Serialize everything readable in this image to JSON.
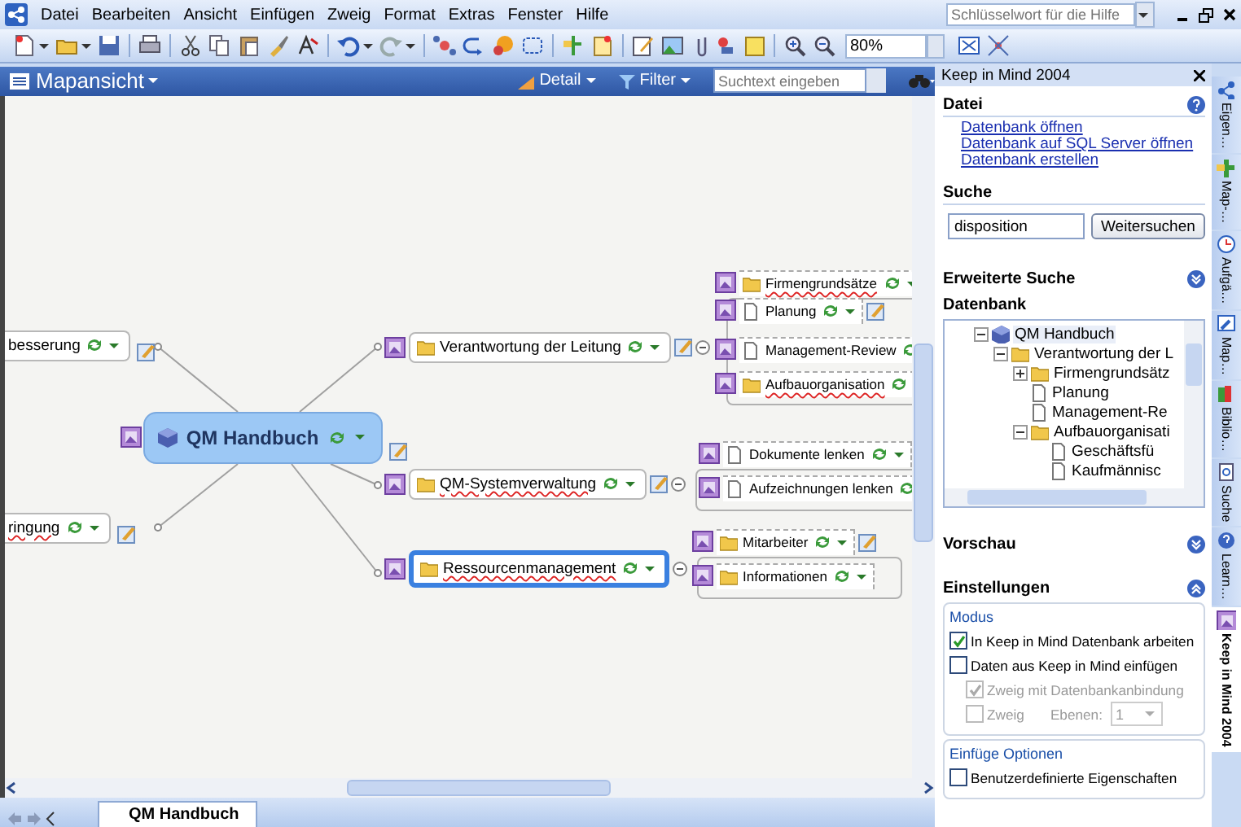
{
  "menu": [
    "Datei",
    "Bearbeiten",
    "Ansicht",
    "Einfügen",
    "Zweig",
    "Format",
    "Extras",
    "Fenster",
    "Hilfe"
  ],
  "help_search": {
    "placeholder": "Schlüsselwort für die Hilfe"
  },
  "toolbar": {
    "zoom": "80%"
  },
  "map_view": {
    "title": "Mapansicht",
    "detail_button": "Detail",
    "filter_button": "Filter",
    "search": {
      "placeholder": "Suchtext eingeben"
    },
    "central_topic": {
      "label": "QM Handbuch",
      "note": true
    },
    "left_topics": [
      {
        "label": "besserung",
        "spelling_error": false,
        "selected": false,
        "note": true
      },
      {
        "label": "ringung",
        "spelling_error": true,
        "selected": false,
        "note": true
      }
    ],
    "right_topics": [
      {
        "label": "Verantwortung der Leitung",
        "kind": "folder",
        "spelling_error": false,
        "selected": false,
        "expanded": true,
        "note": true,
        "children": [
          {
            "label": "Firmengrundsätze",
            "kind": "folder",
            "spelling_error": true,
            "selected": false,
            "note": false
          },
          {
            "label": "Planung",
            "kind": "document",
            "spelling_error": false,
            "selected": false,
            "note": true
          },
          {
            "label": "Management-Review",
            "kind": "document",
            "spelling_error": false,
            "selected": false,
            "note": false
          },
          {
            "label": "Aufbauorganisation",
            "kind": "folder",
            "spelling_error": true,
            "selected": false,
            "note": false
          }
        ]
      },
      {
        "label": "QM-Systemverwaltung",
        "kind": "folder",
        "spelling_error": true,
        "selected": false,
        "expanded": true,
        "note": true,
        "children": [
          {
            "label": "Dokumente lenken",
            "kind": "document",
            "spelling_error": false,
            "selected": false,
            "note": false
          },
          {
            "label": "Aufzeichnungen lenken",
            "kind": "document",
            "spelling_error": false,
            "selected": false,
            "note": false
          }
        ]
      },
      {
        "label": "Ressourcenmanagement",
        "kind": "folder",
        "spelling_error": true,
        "selected": true,
        "expanded": true,
        "note": false,
        "children": [
          {
            "label": "Mitarbeiter",
            "kind": "folder",
            "spelling_error": false,
            "selected": false,
            "note": true
          },
          {
            "label": "Informationen",
            "kind": "folder",
            "spelling_error": false,
            "selected": false,
            "note": false
          }
        ]
      }
    ]
  },
  "document_tabs": [
    {
      "label": "QM Handbuch",
      "selected": true
    }
  ],
  "task_pane": {
    "title": "Keep in Mind 2004",
    "sections": [
      {
        "kind": "links",
        "title": "Datei",
        "links": [
          "Datenbank öffnen",
          "Datenbank auf SQL Server öffnen",
          "Datenbank erstellen"
        ]
      },
      {
        "kind": "search",
        "title": "Suche",
        "value": "disposition",
        "button": "Weitersuchen"
      },
      {
        "kind": "header",
        "title": "Erweiterte Suche",
        "expanded": false
      },
      {
        "kind": "tree",
        "title": "Datenbank",
        "tree": [
          {
            "label": "QM Handbuch",
            "kind": "book",
            "expanded": true,
            "selected": true,
            "children": [
              {
                "label": "Verantwortung der L",
                "kind": "folder",
                "expanded": true,
                "selected": false,
                "children": [
                  {
                    "label": "Firmengrundsätz",
                    "kind": "folder",
                    "expanded": false,
                    "selected": false
                  },
                  {
                    "label": "Planung",
                    "kind": "document",
                    "selected": false
                  },
                  {
                    "label": "Management-Re",
                    "kind": "document",
                    "selected": false
                  },
                  {
                    "label": "Aufbauorganisati",
                    "kind": "folder",
                    "expanded": true,
                    "selected": false,
                    "children": [
                      {
                        "label": "Geschäftsfü",
                        "kind": "document",
                        "selected": false
                      },
                      {
                        "label": "Kaufmännisc",
                        "kind": "document",
                        "selected": false
                      }
                    ]
                  }
                ]
              }
            ]
          }
        ]
      },
      {
        "kind": "header",
        "title": "Vorschau",
        "expanded": false
      },
      {
        "kind": "header",
        "title": "Einstellungen",
        "expanded": true
      },
      {
        "kind": "group",
        "title": "Modus",
        "options": [
          {
            "kind": "checkbox",
            "label": "In Keep in Mind Datenbank arbeiten",
            "checked": true,
            "disabled": false
          },
          {
            "kind": "checkbox",
            "label": "Daten aus Keep in Mind einfügen",
            "checked": false,
            "disabled": false,
            "children": [
              {
                "kind": "checkbox",
                "label": "Zweig mit Datenbankanbindung",
                "checked": true,
                "disabled": true
              },
              {
                "kind": "checkbox",
                "label": "Zweig",
                "checked": false,
                "disabled": true,
                "levels": {
                  "label": "Ebenen:",
                  "value": "1"
                }
              }
            ]
          }
        ]
      },
      {
        "kind": "group",
        "title": "Einfüge Optionen",
        "options": [
          {
            "kind": "checkbox",
            "label": "Benutzerdefinierte Eigenschaften",
            "checked": false,
            "disabled": false
          }
        ]
      }
    ]
  },
  "side_tabs": [
    {
      "label": "Eigen…",
      "selected": false
    },
    {
      "label": "Map-…",
      "selected": false
    },
    {
      "label": "Aufgä…",
      "selected": false
    },
    {
      "label": "Map…",
      "selected": false
    },
    {
      "label": "Biblio…",
      "selected": false
    },
    {
      "label": "Suche",
      "selected": false
    },
    {
      "label": "Learn…",
      "selected": false
    },
    {
      "label": "Keep in Mind 2004",
      "selected": true
    }
  ]
}
